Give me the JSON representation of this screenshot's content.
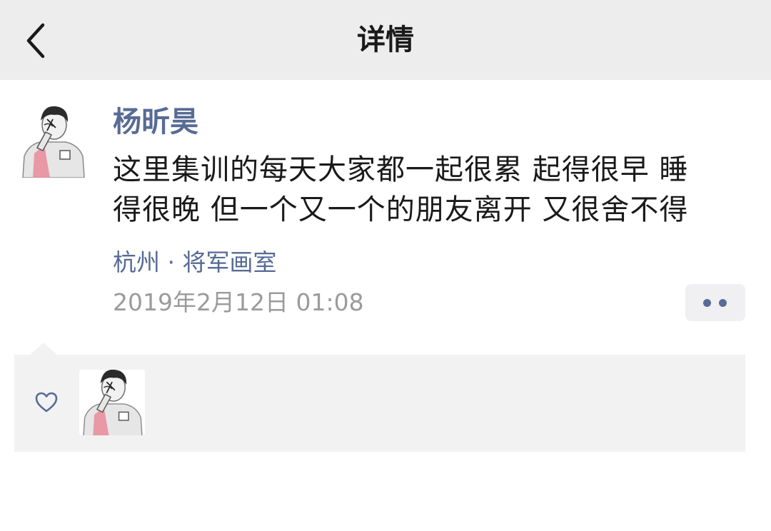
{
  "header": {
    "title": "详情",
    "back_icon": "chevron-left-icon"
  },
  "post": {
    "author": "杨昕昊",
    "text_lines": [
      "这里集训的每天大家都一起很累 起得很早 睡",
      "得很晚 但一个又一个的朋友离开 又很舍不得"
    ],
    "location": "杭州 · 将军画室",
    "timestamp": "2019年2月12日 01:08",
    "more_icon": "more-dots-icon"
  },
  "likes": {
    "icon": "heart-outline-icon",
    "liker_count": 1
  },
  "colors": {
    "header_bg": "#ededed",
    "link_blue": "#576b95",
    "timestamp_gray": "#9b9b9b",
    "likes_bg": "#f2f2f2"
  }
}
